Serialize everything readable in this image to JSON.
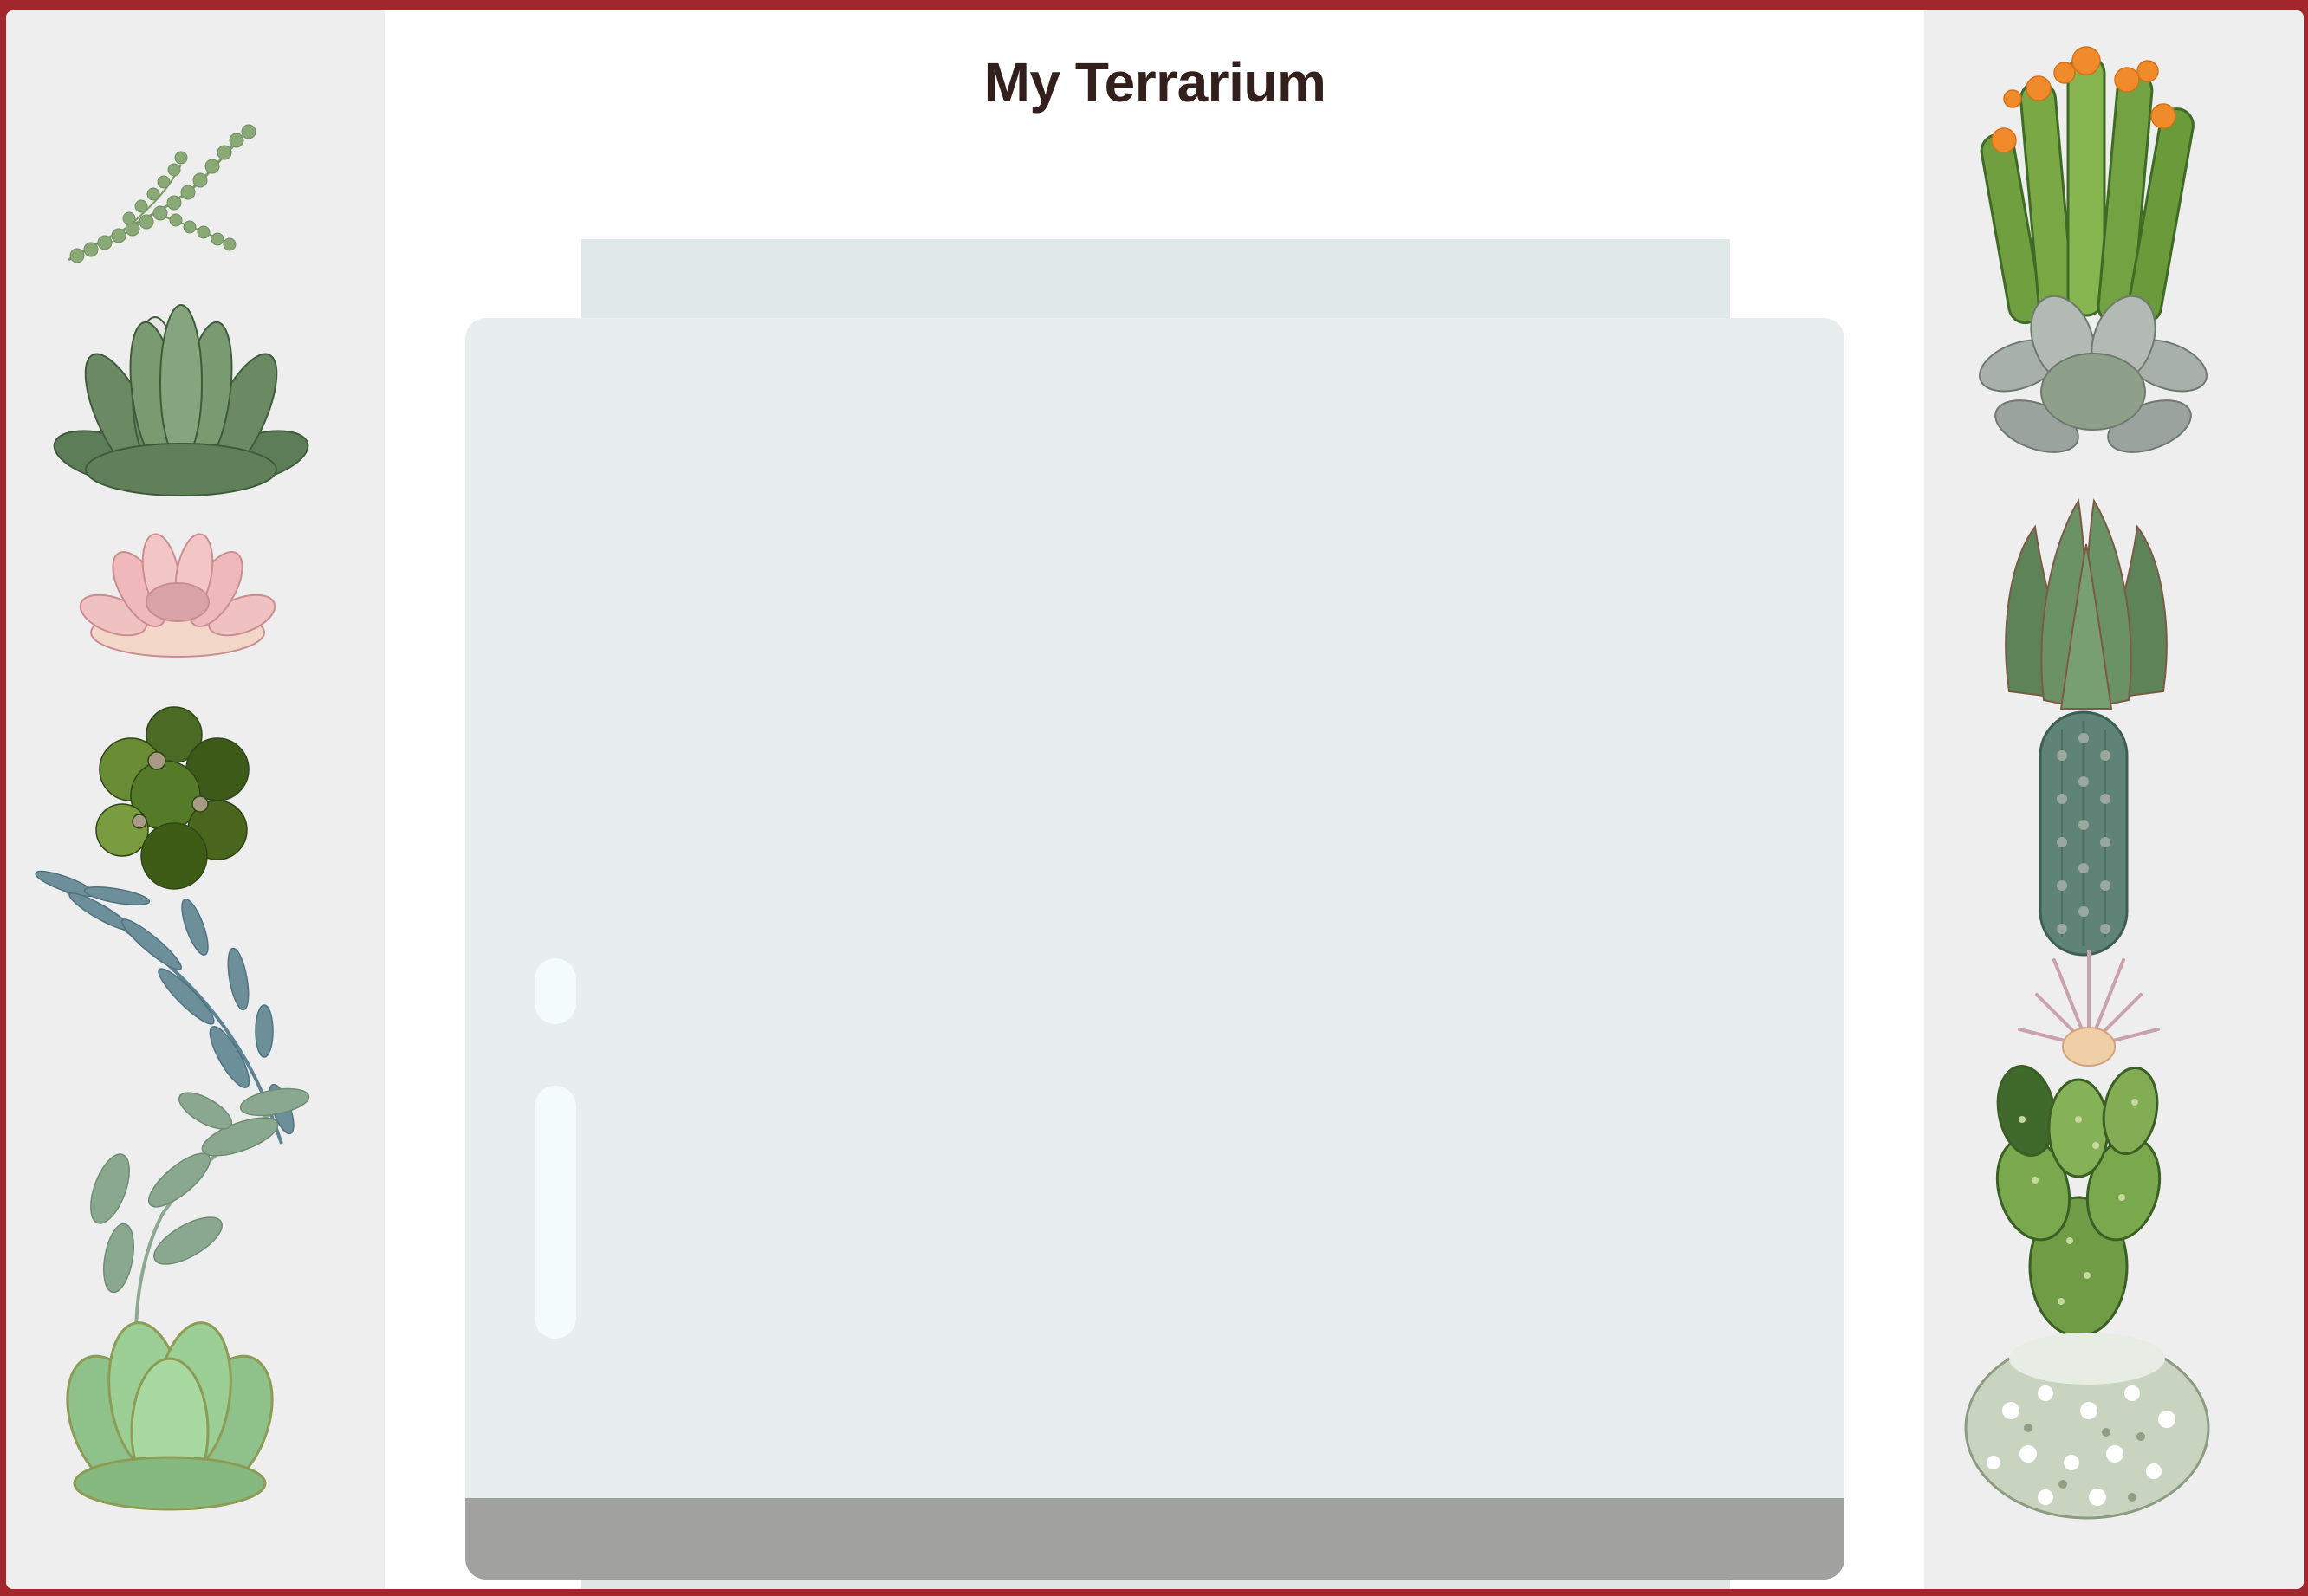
{
  "page": {
    "title": "My Terrarium"
  },
  "colors": {
    "frame": "#a1272c",
    "column_background": "#eeeeee",
    "jar_glass": "#e8eded",
    "jar_top": "#e1e8e8",
    "glare": "#f3fbfc",
    "dirt": "#a1a29f",
    "title_text": "#33201c"
  },
  "left_plants": [
    {
      "name": "string-of-pearls",
      "icon": "trailing-pearls-plant-icon"
    },
    {
      "name": "green-rosette-succulent",
      "icon": "succulent-rosette-icon"
    },
    {
      "name": "pink-echeveria",
      "icon": "pink-succulent-icon"
    },
    {
      "name": "dark-green-clover-succulent",
      "icon": "clover-succulent-icon"
    },
    {
      "name": "eucalyptus-sprig",
      "icon": "leafy-branch-icon"
    },
    {
      "name": "sage-leaf-branch",
      "icon": "leafy-branch-icon"
    },
    {
      "name": "jade-succulent",
      "icon": "jade-succulent-icon"
    }
  ],
  "right_plants": [
    {
      "name": "flowering-finger-cactus",
      "icon": "flowering-cactus-icon"
    },
    {
      "name": "silver-succulent",
      "icon": "silver-succulent-icon"
    },
    {
      "name": "aloe-succulent",
      "icon": "aloe-icon"
    },
    {
      "name": "spiny-column-cactus",
      "icon": "column-cactus-icon"
    },
    {
      "name": "air-plant-flower",
      "icon": "air-plant-icon"
    },
    {
      "name": "paddle-cactus",
      "icon": "paddle-cactus-icon"
    },
    {
      "name": "snowball-cactus",
      "icon": "ball-cactus-icon"
    }
  ]
}
